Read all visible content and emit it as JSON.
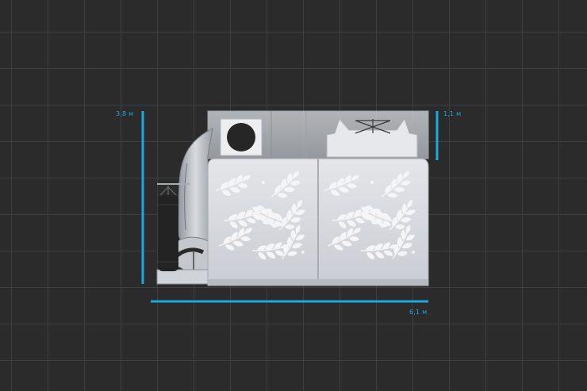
{
  "dimensions": {
    "height_label": "3,8 м",
    "roof_label": "1,1 м",
    "width_label": "6,1 м"
  },
  "colors": {
    "background": "#2b2b2b",
    "grid_line": "#3e3e3e",
    "dimension_line": "#1ea8e0",
    "panel": "#d9dbe0",
    "panel_cutout": "#f4f4f6",
    "glass": "#b8bcc2",
    "dark_detail": "#2a2a2a"
  },
  "icons": [
    "leaf-pattern-icon",
    "punching-bag-icon",
    "slide-icon",
    "ventilation-fan-icon"
  ]
}
